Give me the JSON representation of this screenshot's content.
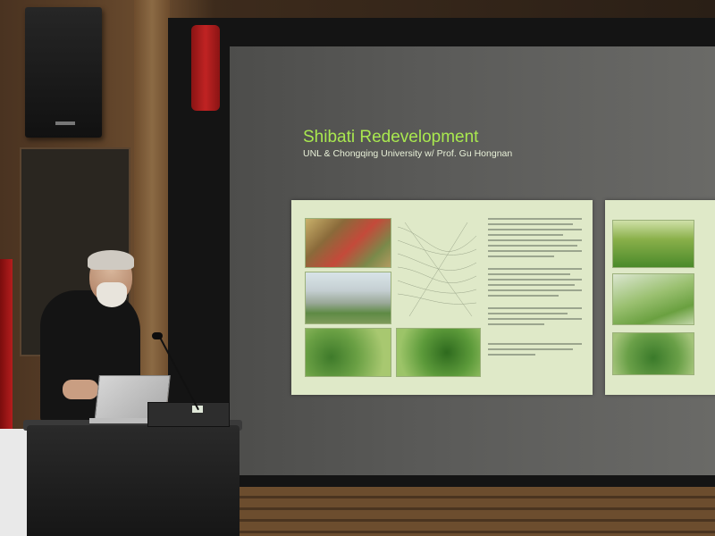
{
  "slide": {
    "title": "Shibati Redevelopment",
    "subtitle": "UNL & Chongqing University w/ Prof. Gu Hongnan"
  },
  "colors": {
    "title_green": "#a9e84f",
    "screen_gray": "#5a5a58",
    "wall_wood": "#6e4e30"
  }
}
